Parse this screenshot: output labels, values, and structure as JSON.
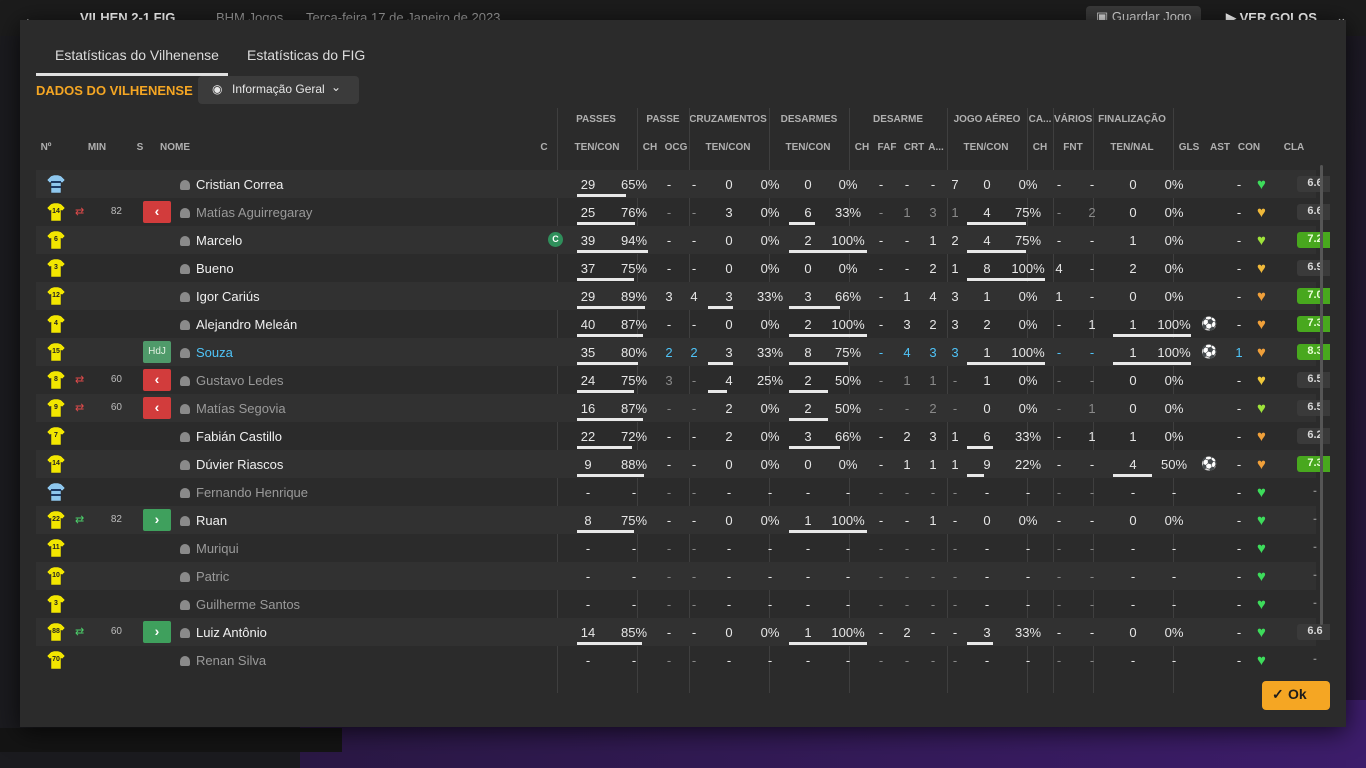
{
  "topbar": {
    "back": "←",
    "score": "VILHEN 2-1 FIG",
    "competition": "BHM Jogos",
    "date": "Terça-feira 17 de Janeiro de 2023",
    "save_label": "Guardar Jogo",
    "goals_label": "VER GOLOS"
  },
  "tabs": [
    "Estatísticas do Vilhenense",
    "Estatísticas do FIG"
  ],
  "section_title": "DADOS DO VILHENENSE",
  "view_select": "Informação Geral",
  "ok_label": "Ok",
  "groups": {
    "passes": "PASSES",
    "passe": "PASSE",
    "cruzamentos": "CRUZAMENTOS",
    "desarmes": "DESARMES",
    "desarme": "DESARME",
    "jogo_aereo": "JOGO AÉREO",
    "ca": "CA...",
    "varios": "VÁRIOS",
    "finalizacao": "FINALIZAÇÃO"
  },
  "headers": {
    "no": "Nº",
    "min": "MIN",
    "s": "S",
    "nome": "NOME",
    "c": "C",
    "passes_tc": "TEN/CON",
    "passe_ch": "CH",
    "passe_ocg": "OCG",
    "cruz_tc": "TEN/CON",
    "des_tc": "TEN/CON",
    "desm_ch": "CH",
    "desm_faf": "FAF",
    "desm_crt": "CRT",
    "desm_a": "A...",
    "aereo_tc": "TEN/CON",
    "ca_ch": "CH",
    "var_fnt": "FNT",
    "fin_tn": "TEN/NAL",
    "gls": "GLS",
    "ast": "AST",
    "con": "CON",
    "cla": "CLA"
  },
  "players": [
    {
      "no": "GK",
      "kit": "gk",
      "min": "",
      "sub": "",
      "s": "",
      "name": "Cristian Correa",
      "style": "",
      "cap": false,
      "pt": "29",
      "pp": "65%",
      "pbar": 0.65,
      "pch": "-",
      "pocg": "-",
      "ct": "0",
      "cp": "0%",
      "cbar": 0,
      "dt": "0",
      "dp": "0%",
      "dbar": 0,
      "dch": "-",
      "faf": "-",
      "crt": "-",
      "da": "7",
      "at": "0",
      "ap": "0%",
      "abar": 0,
      "cach": "-",
      "fnt": "-",
      "ft": "0",
      "fp": "0%",
      "fbar": 0,
      "gls": "",
      "ast": "-",
      "con": "#3ddc5b",
      "cla": "6.6",
      "cla_style": ""
    },
    {
      "no": "14",
      "kit": "y",
      "min": "82",
      "sub": "out",
      "s": "red",
      "name": "Matías Aguirregaray",
      "style": "dim",
      "cap": false,
      "pt": "25",
      "pp": "76%",
      "pbar": 0.76,
      "pch": "-",
      "pocg": "-",
      "ct": "3",
      "cp": "0%",
      "cbar": 0,
      "dt": "6",
      "dp": "33%",
      "dbar": 0.33,
      "dch": "-",
      "faf": "1",
      "crt": "3",
      "da": "1",
      "at": "4",
      "ap": "75%",
      "abar": 0.75,
      "cach": "-",
      "fnt": "2",
      "ft": "0",
      "fp": "0%",
      "fbar": 0,
      "gls": "",
      "ast": "-",
      "con": "#f0b93a",
      "cla": "6.6",
      "cla_style": ""
    },
    {
      "no": "6",
      "kit": "y",
      "min": "",
      "sub": "",
      "s": "",
      "name": "Marcelo",
      "style": "",
      "cap": true,
      "pt": "39",
      "pp": "94%",
      "pbar": 0.94,
      "pch": "-",
      "pocg": "-",
      "ct": "0",
      "cp": "0%",
      "cbar": 0,
      "dt": "2",
      "dp": "100%",
      "dbar": 1,
      "dch": "-",
      "faf": "-",
      "crt": "1",
      "da": "2",
      "at": "4",
      "ap": "75%",
      "abar": 0.75,
      "cach": "-",
      "fnt": "-",
      "ft": "1",
      "fp": "0%",
      "fbar": 0,
      "gls": "",
      "ast": "-",
      "con": "#9ee33a",
      "cla": "7.2",
      "cla_style": "good"
    },
    {
      "no": "3",
      "kit": "y",
      "min": "",
      "sub": "",
      "s": "",
      "name": "Bueno",
      "style": "",
      "cap": false,
      "pt": "37",
      "pp": "75%",
      "pbar": 0.75,
      "pch": "-",
      "pocg": "-",
      "ct": "0",
      "cp": "0%",
      "cbar": 0,
      "dt": "0",
      "dp": "0%",
      "dbar": 0,
      "dch": "-",
      "faf": "-",
      "crt": "2",
      "da": "1",
      "at": "8",
      "ap": "100%",
      "abar": 1,
      "cach": "4",
      "fnt": "-",
      "ft": "2",
      "fp": "0%",
      "fbar": 0,
      "gls": "",
      "ast": "-",
      "con": "#f0b93a",
      "cla": "6.9",
      "cla_style": ""
    },
    {
      "no": "12",
      "kit": "y",
      "min": "",
      "sub": "",
      "s": "",
      "name": "Igor Cariús",
      "style": "",
      "cap": false,
      "pt": "29",
      "pp": "89%",
      "pbar": 0.89,
      "pch": "3",
      "pocg": "4",
      "ct": "3",
      "cp": "33%",
      "cbar": 0.33,
      "dt": "3",
      "dp": "66%",
      "dbar": 0.66,
      "dch": "-",
      "faf": "1",
      "crt": "4",
      "da": "3",
      "at": "1",
      "ap": "0%",
      "abar": 0,
      "cach": "1",
      "fnt": "-",
      "ft": "0",
      "fp": "0%",
      "fbar": 0,
      "gls": "",
      "ast": "-",
      "con": "#f0a03a",
      "cla": "7.0",
      "cla_style": "good"
    },
    {
      "no": "4",
      "kit": "y",
      "min": "",
      "sub": "",
      "s": "",
      "name": "Alejandro Meleán",
      "style": "",
      "cap": false,
      "pt": "40",
      "pp": "87%",
      "pbar": 0.87,
      "pch": "-",
      "pocg": "-",
      "ct": "0",
      "cp": "0%",
      "cbar": 0,
      "dt": "2",
      "dp": "100%",
      "dbar": 1,
      "dch": "-",
      "faf": "3",
      "crt": "2",
      "da": "3",
      "at": "2",
      "ap": "0%",
      "abar": 0,
      "cach": "-",
      "fnt": "1",
      "ft": "1",
      "fp": "100%",
      "fbar": 1,
      "gls": "⚽",
      "ast": "-",
      "con": "#f0a03a",
      "cla": "7.3",
      "cla_style": "good"
    },
    {
      "no": "15",
      "kit": "y",
      "min": "",
      "sub": "",
      "s": "hdj",
      "s_label": "HdJ",
      "name": "Souza",
      "style": "cyan",
      "cap": false,
      "pt": "35",
      "pp": "80%",
      "pbar": 0.8,
      "pch": "2",
      "pocg": "2",
      "ct": "3",
      "cp": "33%",
      "cbar": 0.33,
      "dt": "8",
      "dp": "75%",
      "dbar": 0.75,
      "dch": "-",
      "faf": "4",
      "crt": "3",
      "da": "3",
      "at": "1",
      "ap": "100%",
      "abar": 1,
      "cach": "-",
      "fnt": "-",
      "ft": "1",
      "fp": "100%",
      "fbar": 1,
      "gls": "⚽",
      "ast": "1",
      "con": "#f0a03a",
      "cla": "8.3",
      "cla_style": "good"
    },
    {
      "no": "8",
      "kit": "y",
      "min": "60",
      "sub": "out",
      "s": "red",
      "name": "Gustavo Ledes",
      "style": "dim",
      "cap": false,
      "pt": "24",
      "pp": "75%",
      "pbar": 0.75,
      "pch": "3",
      "pocg": "-",
      "ct": "4",
      "cp": "25%",
      "cbar": 0.25,
      "dt": "2",
      "dp": "50%",
      "dbar": 0.5,
      "dch": "-",
      "faf": "1",
      "crt": "1",
      "da": "-",
      "at": "1",
      "ap": "0%",
      "abar": 0,
      "cach": "-",
      "fnt": "-",
      "ft": "0",
      "fp": "0%",
      "fbar": 0,
      "gls": "",
      "ast": "-",
      "con": "#f0c83a",
      "cla": "6.5",
      "cla_style": ""
    },
    {
      "no": "9",
      "kit": "y",
      "min": "60",
      "sub": "out",
      "s": "red",
      "name": "Matías Segovia",
      "style": "dim",
      "cap": false,
      "pt": "16",
      "pp": "87%",
      "pbar": 0.87,
      "pch": "-",
      "pocg": "-",
      "ct": "2",
      "cp": "0%",
      "cbar": 0,
      "dt": "2",
      "dp": "50%",
      "dbar": 0.5,
      "dch": "-",
      "faf": "-",
      "crt": "2",
      "da": "-",
      "at": "0",
      "ap": "0%",
      "abar": 0,
      "cach": "-",
      "fnt": "1",
      "ft": "0",
      "fp": "0%",
      "fbar": 0,
      "gls": "",
      "ast": "-",
      "con": "#9ee33a",
      "cla": "6.5",
      "cla_style": ""
    },
    {
      "no": "7",
      "kit": "y",
      "min": "",
      "sub": "",
      "s": "",
      "name": "Fabián Castillo",
      "style": "",
      "cap": false,
      "pt": "22",
      "pp": "72%",
      "pbar": 0.72,
      "pch": "-",
      "pocg": "-",
      "ct": "2",
      "cp": "0%",
      "cbar": 0,
      "dt": "3",
      "dp": "66%",
      "dbar": 0.66,
      "dch": "-",
      "faf": "2",
      "crt": "3",
      "da": "1",
      "at": "6",
      "ap": "33%",
      "abar": 0.33,
      "cach": "-",
      "fnt": "1",
      "ft": "1",
      "fp": "0%",
      "fbar": 0,
      "gls": "",
      "ast": "-",
      "con": "#f0a03a",
      "cla": "6.2",
      "cla_style": ""
    },
    {
      "no": "14",
      "kit": "y",
      "min": "",
      "sub": "",
      "s": "",
      "name": "Dúvier Riascos",
      "style": "",
      "cap": false,
      "pt": "9",
      "pp": "88%",
      "pbar": 0.88,
      "pch": "-",
      "pocg": "-",
      "ct": "0",
      "cp": "0%",
      "cbar": 0,
      "dt": "0",
      "dp": "0%",
      "dbar": 0,
      "dch": "-",
      "faf": "1",
      "crt": "1",
      "da": "1",
      "at": "9",
      "ap": "22%",
      "abar": 0.22,
      "cach": "-",
      "fnt": "-",
      "ft": "4",
      "fp": "50%",
      "fbar": 0.5,
      "gls": "⚽",
      "ast": "-",
      "con": "#f0a03a",
      "cla": "7.3",
      "cla_style": "good"
    },
    {
      "no": "GK",
      "kit": "gk",
      "min": "",
      "sub": "",
      "s": "",
      "name": "Fernando Henrique",
      "style": "dim",
      "cap": false,
      "pt": "-",
      "pp": "-",
      "pbar": 0,
      "pch": "-",
      "pocg": "-",
      "ct": "-",
      "cp": "-",
      "cbar": 0,
      "dt": "-",
      "dp": "-",
      "dbar": 0,
      "dch": "-",
      "faf": "-",
      "crt": "-",
      "da": "-",
      "at": "-",
      "ap": "-",
      "abar": 0,
      "cach": "-",
      "fnt": "-",
      "ft": "-",
      "fp": "-",
      "fbar": 0,
      "gls": "",
      "ast": "-",
      "con": "#3ddc5b",
      "cla": "-",
      "cla_style": "none"
    },
    {
      "no": "22",
      "kit": "y",
      "min": "82",
      "sub": "in",
      "s": "green",
      "name": "Ruan",
      "style": "",
      "cap": false,
      "pt": "8",
      "pp": "75%",
      "pbar": 0.75,
      "pch": "-",
      "pocg": "-",
      "ct": "0",
      "cp": "0%",
      "cbar": 0,
      "dt": "1",
      "dp": "100%",
      "dbar": 1,
      "dch": "-",
      "faf": "-",
      "crt": "1",
      "da": "-",
      "at": "0",
      "ap": "0%",
      "abar": 0,
      "cach": "-",
      "fnt": "-",
      "ft": "0",
      "fp": "0%",
      "fbar": 0,
      "gls": "",
      "ast": "-",
      "con": "#3ddc5b",
      "cla": "-",
      "cla_style": "none"
    },
    {
      "no": "11",
      "kit": "y",
      "min": "",
      "sub": "",
      "s": "",
      "name": "Muriqui",
      "style": "dim",
      "cap": false,
      "pt": "-",
      "pp": "-",
      "pbar": 0,
      "pch": "-",
      "pocg": "-",
      "ct": "-",
      "cp": "-",
      "cbar": 0,
      "dt": "-",
      "dp": "-",
      "dbar": 0,
      "dch": "-",
      "faf": "-",
      "crt": "-",
      "da": "-",
      "at": "-",
      "ap": "-",
      "abar": 0,
      "cach": "-",
      "fnt": "-",
      "ft": "-",
      "fp": "-",
      "fbar": 0,
      "gls": "",
      "ast": "-",
      "con": "#3ddc5b",
      "cla": "-",
      "cla_style": "none"
    },
    {
      "no": "10",
      "kit": "y",
      "min": "",
      "sub": "",
      "s": "",
      "name": "Patric",
      "style": "dim",
      "cap": false,
      "pt": "-",
      "pp": "-",
      "pbar": 0,
      "pch": "-",
      "pocg": "-",
      "ct": "-",
      "cp": "-",
      "cbar": 0,
      "dt": "-",
      "dp": "-",
      "dbar": 0,
      "dch": "-",
      "faf": "-",
      "crt": "-",
      "da": "-",
      "at": "-",
      "ap": "-",
      "abar": 0,
      "cach": "-",
      "fnt": "-",
      "ft": "-",
      "fp": "-",
      "fbar": 0,
      "gls": "",
      "ast": "-",
      "con": "#3ddc5b",
      "cla": "-",
      "cla_style": "none"
    },
    {
      "no": "3",
      "kit": "y",
      "min": "",
      "sub": "",
      "s": "",
      "name": "Guilherme Santos",
      "style": "dim",
      "cap": false,
      "pt": "-",
      "pp": "-",
      "pbar": 0,
      "pch": "-",
      "pocg": "-",
      "ct": "-",
      "cp": "-",
      "cbar": 0,
      "dt": "-",
      "dp": "-",
      "dbar": 0,
      "dch": "-",
      "faf": "-",
      "crt": "-",
      "da": "-",
      "at": "-",
      "ap": "-",
      "abar": 0,
      "cach": "-",
      "fnt": "-",
      "ft": "-",
      "fp": "-",
      "fbar": 0,
      "gls": "",
      "ast": "-",
      "con": "#3ddc5b",
      "cla": "-",
      "cla_style": "none"
    },
    {
      "no": "88",
      "kit": "y",
      "min": "60",
      "sub": "in",
      "s": "green",
      "name": "Luiz Antônio",
      "style": "",
      "cap": false,
      "pt": "14",
      "pp": "85%",
      "pbar": 0.85,
      "pch": "-",
      "pocg": "-",
      "ct": "0",
      "cp": "0%",
      "cbar": 0,
      "dt": "1",
      "dp": "100%",
      "dbar": 1,
      "dch": "-",
      "faf": "2",
      "crt": "-",
      "da": "-",
      "at": "3",
      "ap": "33%",
      "abar": 0.33,
      "cach": "-",
      "fnt": "-",
      "ft": "0",
      "fp": "0%",
      "fbar": 0,
      "gls": "",
      "ast": "-",
      "con": "#3ddc5b",
      "cla": "6.6",
      "cla_style": ""
    },
    {
      "no": "70",
      "kit": "y",
      "min": "",
      "sub": "",
      "s": "",
      "name": "Renan Silva",
      "style": "dim",
      "cap": false,
      "pt": "-",
      "pp": "-",
      "pbar": 0,
      "pch": "-",
      "pocg": "-",
      "ct": "-",
      "cp": "-",
      "cbar": 0,
      "dt": "-",
      "dp": "-",
      "dbar": 0,
      "dch": "-",
      "faf": "-",
      "crt": "-",
      "da": "-",
      "at": "-",
      "ap": "-",
      "abar": 0,
      "cach": "-",
      "fnt": "-",
      "ft": "-",
      "fp": "-",
      "fbar": 0,
      "gls": "",
      "ast": "-",
      "con": "#3ddc5b",
      "cla": "-",
      "cla_style": "none"
    }
  ]
}
